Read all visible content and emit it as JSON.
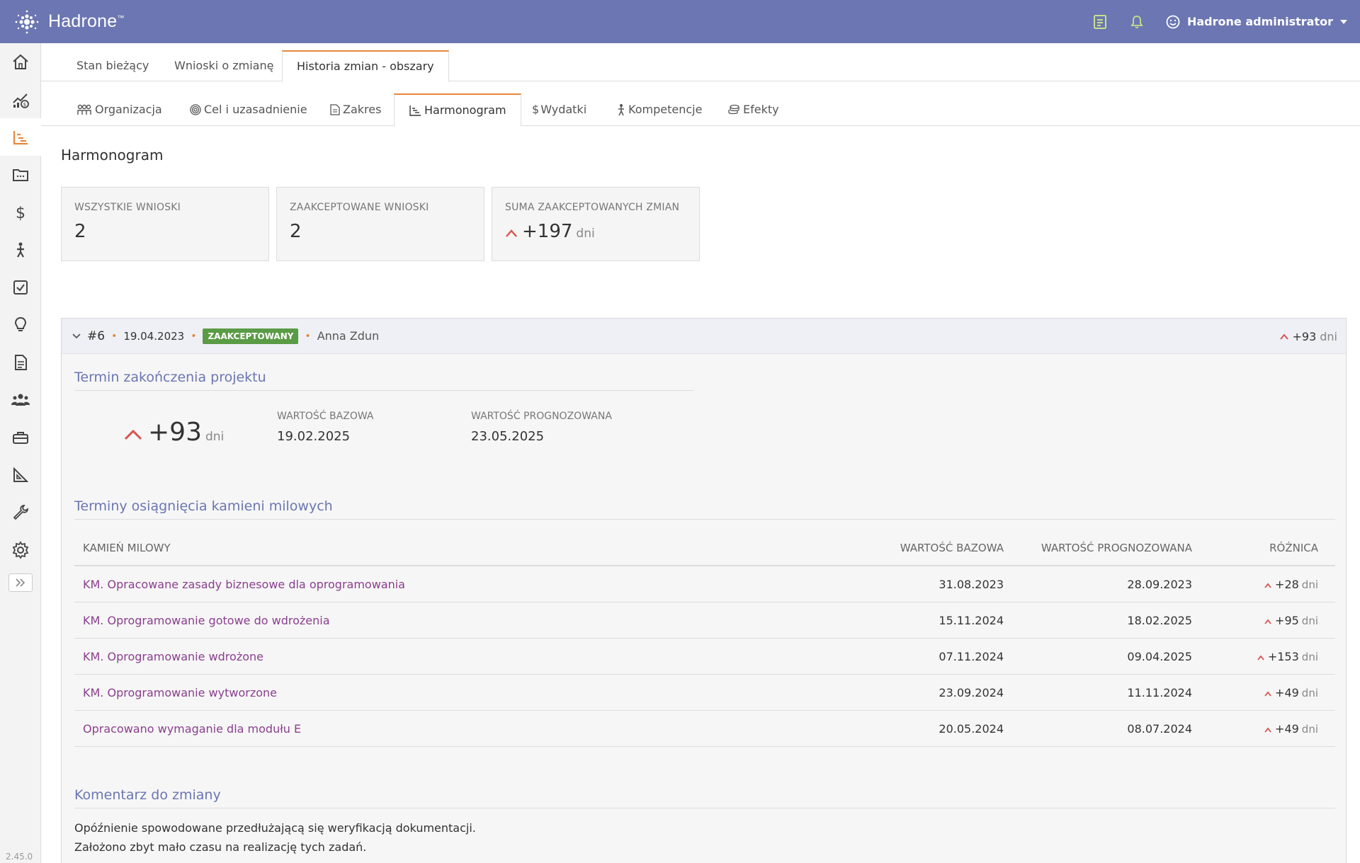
{
  "app": {
    "name": "Hadrone",
    "trademark": "™",
    "version": "2.45.0"
  },
  "header": {
    "user_name": "Hadrone administrator",
    "icons": [
      "notes-icon",
      "bell-icon",
      "user-smile-icon"
    ],
    "accent": "#6b76b2"
  },
  "sidebar": {
    "items": [
      "home-icon",
      "chart-dollar-icon",
      "schedule-icon",
      "folder-icon",
      "dollar-icon",
      "person-icon",
      "checkbox-icon",
      "lightbulb-icon",
      "document-icon",
      "team-icon",
      "toolbox-icon",
      "triangle-ruler-icon",
      "wrench-icon",
      "gear-icon"
    ],
    "active_index": 2,
    "expand_icon": "double-chevron-right-icon"
  },
  "tabs_main": [
    "Stan bieżący",
    "Wnioski o zmianę",
    "Historia zmian - obszary"
  ],
  "tabs_sub": [
    {
      "label": "Organizacja",
      "icon": "people-icon"
    },
    {
      "label": "Cel i uzasadnienie",
      "icon": "target-icon"
    },
    {
      "label": "Zakres",
      "icon": "file-icon"
    },
    {
      "label": "Harmonogram",
      "icon": "schedule-icon"
    },
    {
      "label": "Wydatki",
      "icon": "dollar-icon"
    },
    {
      "label": "Kompetencje",
      "icon": "person-icon"
    },
    {
      "label": "Efekty",
      "icon": "coins-icon"
    }
  ],
  "page_title": "Harmonogram",
  "stats": {
    "all_label": "WSZYSTKIE WNIOSKI",
    "all_value": "2",
    "accepted_label": "ZAAKCEPTOWANE WNIOSKI",
    "accepted_value": "2",
    "sum_label": "SUMA ZAAKCEPTOWANYCH ZMIAN",
    "sum_value": "+197",
    "sum_unit": "dni"
  },
  "change": {
    "id": "#6",
    "date": "19.04.2023",
    "status": "ZAAKCEPTOWANY",
    "author": "Anna Zdun",
    "delta": "+93",
    "delta_unit": "dni",
    "end_section_title": "Termin zakończenia projektu",
    "end_delta": "+93",
    "end_unit": "dni",
    "base_label": "WARTOŚĆ BAZOWA",
    "base_value": "19.02.2025",
    "forecast_label": "WARTOŚĆ PROGNOZOWANA",
    "forecast_value": "23.05.2025",
    "milestones_title": "Terminy osiągnięcia kamieni milowych",
    "table_headers": [
      "KAMIEŃ MILOWY",
      "WARTOŚĆ BAZOWA",
      "WARTOŚĆ PROGNOZOWANA",
      "RÓŻNICA"
    ],
    "milestones": [
      {
        "name": "KM. Opracowane zasady biznesowe dla oprogramowania",
        "base": "31.08.2023",
        "forecast": "28.09.2023",
        "diff": "+28",
        "unit": "dni"
      },
      {
        "name": "KM. Oprogramowanie gotowe do wdrożenia",
        "base": "15.11.2024",
        "forecast": "18.02.2025",
        "diff": "+95",
        "unit": "dni"
      },
      {
        "name": "KM. Oprogramowanie wdrożone",
        "base": "07.11.2024",
        "forecast": "09.04.2025",
        "diff": "+153",
        "unit": "dni"
      },
      {
        "name": "KM. Oprogramowanie wytworzone",
        "base": "23.09.2024",
        "forecast": "11.11.2024",
        "diff": "+49",
        "unit": "dni"
      },
      {
        "name": "Opracowano wymaganie dla modułu E",
        "base": "20.05.2024",
        "forecast": "08.07.2024",
        "diff": "+49",
        "unit": "dni"
      }
    ],
    "comment_title": "Komentarz do zmiany",
    "comment_lines": [
      "Opóźnienie spowodowane przedłużającą się weryfikacją dokumentacji.",
      "Założono zbyt mało czasu na realizację tych zadań."
    ]
  }
}
